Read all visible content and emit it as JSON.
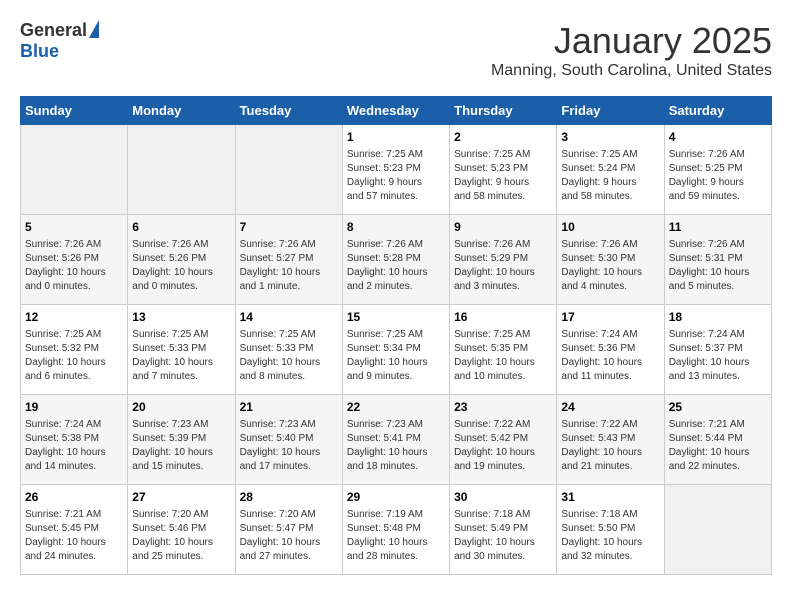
{
  "header": {
    "logo_general": "General",
    "logo_blue": "Blue",
    "title": "January 2025",
    "subtitle": "Manning, South Carolina, United States"
  },
  "days_of_week": [
    "Sunday",
    "Monday",
    "Tuesday",
    "Wednesday",
    "Thursday",
    "Friday",
    "Saturday"
  ],
  "weeks": [
    [
      {
        "day": "",
        "info": ""
      },
      {
        "day": "",
        "info": ""
      },
      {
        "day": "",
        "info": ""
      },
      {
        "day": "1",
        "info": "Sunrise: 7:25 AM\nSunset: 5:23 PM\nDaylight: 9 hours\nand 57 minutes."
      },
      {
        "day": "2",
        "info": "Sunrise: 7:25 AM\nSunset: 5:23 PM\nDaylight: 9 hours\nand 58 minutes."
      },
      {
        "day": "3",
        "info": "Sunrise: 7:25 AM\nSunset: 5:24 PM\nDaylight: 9 hours\nand 58 minutes."
      },
      {
        "day": "4",
        "info": "Sunrise: 7:26 AM\nSunset: 5:25 PM\nDaylight: 9 hours\nand 59 minutes."
      }
    ],
    [
      {
        "day": "5",
        "info": "Sunrise: 7:26 AM\nSunset: 5:26 PM\nDaylight: 10 hours\nand 0 minutes."
      },
      {
        "day": "6",
        "info": "Sunrise: 7:26 AM\nSunset: 5:26 PM\nDaylight: 10 hours\nand 0 minutes."
      },
      {
        "day": "7",
        "info": "Sunrise: 7:26 AM\nSunset: 5:27 PM\nDaylight: 10 hours\nand 1 minute."
      },
      {
        "day": "8",
        "info": "Sunrise: 7:26 AM\nSunset: 5:28 PM\nDaylight: 10 hours\nand 2 minutes."
      },
      {
        "day": "9",
        "info": "Sunrise: 7:26 AM\nSunset: 5:29 PM\nDaylight: 10 hours\nand 3 minutes."
      },
      {
        "day": "10",
        "info": "Sunrise: 7:26 AM\nSunset: 5:30 PM\nDaylight: 10 hours\nand 4 minutes."
      },
      {
        "day": "11",
        "info": "Sunrise: 7:26 AM\nSunset: 5:31 PM\nDaylight: 10 hours\nand 5 minutes."
      }
    ],
    [
      {
        "day": "12",
        "info": "Sunrise: 7:25 AM\nSunset: 5:32 PM\nDaylight: 10 hours\nand 6 minutes."
      },
      {
        "day": "13",
        "info": "Sunrise: 7:25 AM\nSunset: 5:33 PM\nDaylight: 10 hours\nand 7 minutes."
      },
      {
        "day": "14",
        "info": "Sunrise: 7:25 AM\nSunset: 5:33 PM\nDaylight: 10 hours\nand 8 minutes."
      },
      {
        "day": "15",
        "info": "Sunrise: 7:25 AM\nSunset: 5:34 PM\nDaylight: 10 hours\nand 9 minutes."
      },
      {
        "day": "16",
        "info": "Sunrise: 7:25 AM\nSunset: 5:35 PM\nDaylight: 10 hours\nand 10 minutes."
      },
      {
        "day": "17",
        "info": "Sunrise: 7:24 AM\nSunset: 5:36 PM\nDaylight: 10 hours\nand 11 minutes."
      },
      {
        "day": "18",
        "info": "Sunrise: 7:24 AM\nSunset: 5:37 PM\nDaylight: 10 hours\nand 13 minutes."
      }
    ],
    [
      {
        "day": "19",
        "info": "Sunrise: 7:24 AM\nSunset: 5:38 PM\nDaylight: 10 hours\nand 14 minutes."
      },
      {
        "day": "20",
        "info": "Sunrise: 7:23 AM\nSunset: 5:39 PM\nDaylight: 10 hours\nand 15 minutes."
      },
      {
        "day": "21",
        "info": "Sunrise: 7:23 AM\nSunset: 5:40 PM\nDaylight: 10 hours\nand 17 minutes."
      },
      {
        "day": "22",
        "info": "Sunrise: 7:23 AM\nSunset: 5:41 PM\nDaylight: 10 hours\nand 18 minutes."
      },
      {
        "day": "23",
        "info": "Sunrise: 7:22 AM\nSunset: 5:42 PM\nDaylight: 10 hours\nand 19 minutes."
      },
      {
        "day": "24",
        "info": "Sunrise: 7:22 AM\nSunset: 5:43 PM\nDaylight: 10 hours\nand 21 minutes."
      },
      {
        "day": "25",
        "info": "Sunrise: 7:21 AM\nSunset: 5:44 PM\nDaylight: 10 hours\nand 22 minutes."
      }
    ],
    [
      {
        "day": "26",
        "info": "Sunrise: 7:21 AM\nSunset: 5:45 PM\nDaylight: 10 hours\nand 24 minutes."
      },
      {
        "day": "27",
        "info": "Sunrise: 7:20 AM\nSunset: 5:46 PM\nDaylight: 10 hours\nand 25 minutes."
      },
      {
        "day": "28",
        "info": "Sunrise: 7:20 AM\nSunset: 5:47 PM\nDaylight: 10 hours\nand 27 minutes."
      },
      {
        "day": "29",
        "info": "Sunrise: 7:19 AM\nSunset: 5:48 PM\nDaylight: 10 hours\nand 28 minutes."
      },
      {
        "day": "30",
        "info": "Sunrise: 7:18 AM\nSunset: 5:49 PM\nDaylight: 10 hours\nand 30 minutes."
      },
      {
        "day": "31",
        "info": "Sunrise: 7:18 AM\nSunset: 5:50 PM\nDaylight: 10 hours\nand 32 minutes."
      },
      {
        "day": "",
        "info": ""
      }
    ]
  ]
}
